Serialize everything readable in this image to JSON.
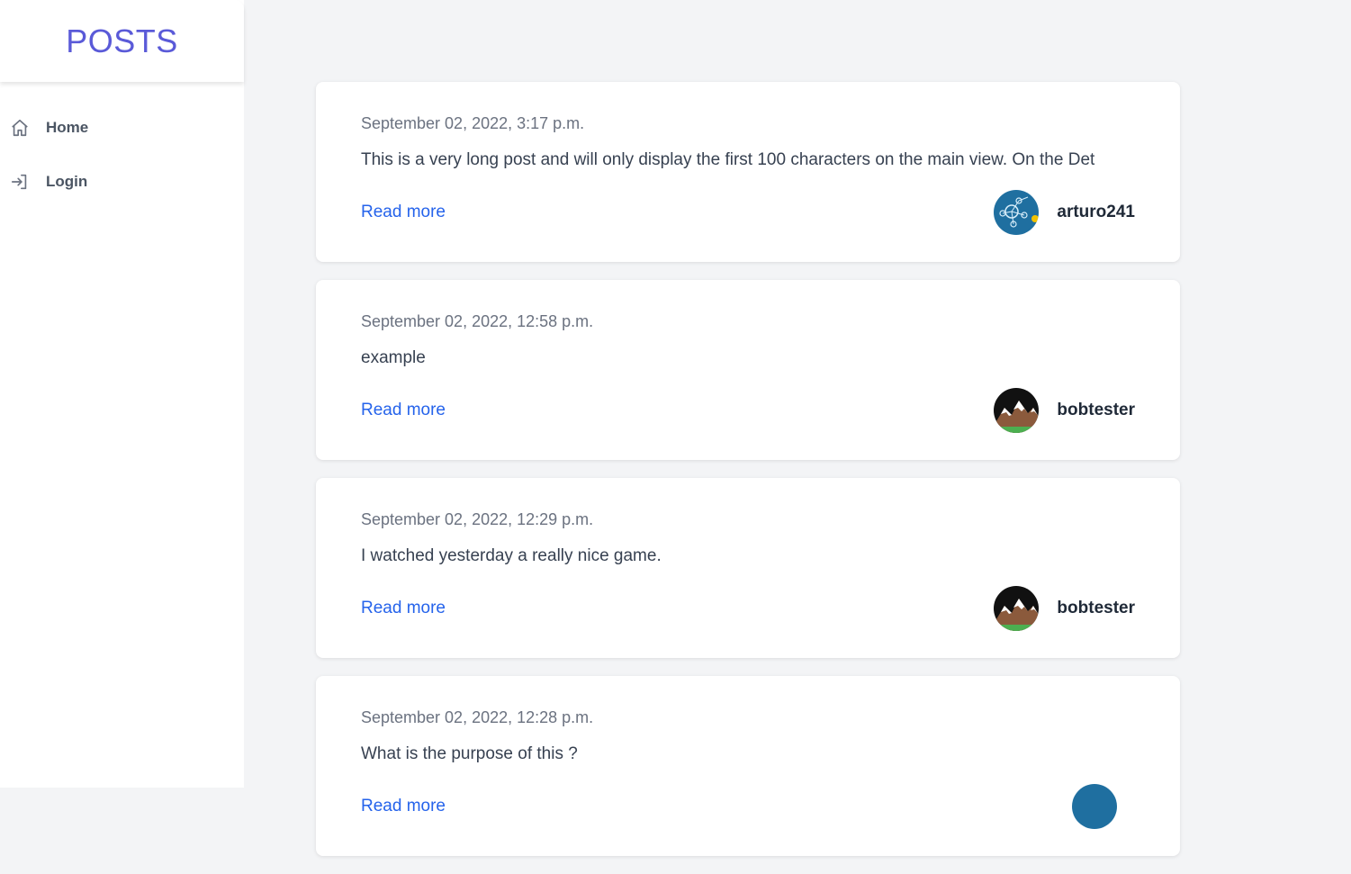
{
  "brand": {
    "title": "POSTS",
    "color": "#5a5ad8"
  },
  "nav": {
    "items": [
      {
        "label": "Home",
        "icon": "home-icon"
      },
      {
        "label": "Login",
        "icon": "login-icon"
      }
    ]
  },
  "posts": [
    {
      "date": "September 02, 2022, 3:17 p.m.",
      "excerpt": "This is a very long post and will only display the first 100 characters on the main view. On the Det",
      "read_more": "Read more",
      "author": "arturo241",
      "avatar": "network-avatar"
    },
    {
      "date": "September 02, 2022, 12:58 p.m.",
      "excerpt": "example",
      "read_more": "Read more",
      "author": "bobtester",
      "avatar": "mountain-avatar"
    },
    {
      "date": "September 02, 2022, 12:29 p.m.",
      "excerpt": "I watched yesterday a really nice game.",
      "read_more": "Read more",
      "author": "bobtester",
      "avatar": "mountain-avatar"
    },
    {
      "date": "September 02, 2022, 12:28 p.m.",
      "excerpt": "What is the purpose of this ?",
      "read_more": "Read more",
      "author": "",
      "avatar": "network-avatar"
    }
  ],
  "colors": {
    "link": "#2563eb",
    "background": "#f3f4f6"
  }
}
